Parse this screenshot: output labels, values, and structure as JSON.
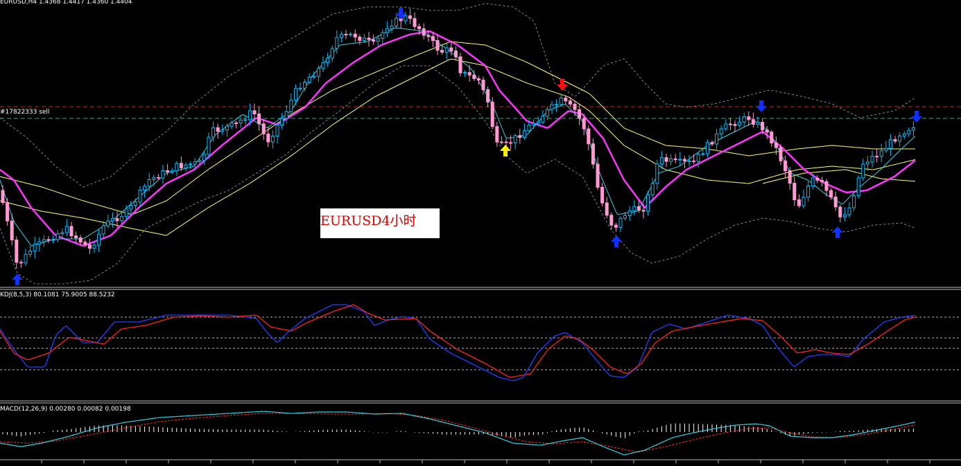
{
  "chart_data": [
    {
      "type": "candlestick",
      "panel": "main",
      "title": "EURUSD,H4  1.4368 1.4417 1.4360 1.4404",
      "symbol": "EURUSD",
      "timeframe": "H4",
      "ohlc_last": {
        "open": 1.4368,
        "high": 1.4417,
        "low": 1.436,
        "close": 1.4404
      },
      "order_line_label": "#17822333 sell",
      "annotation": "EURUSD4小时",
      "colors": {
        "bull": "#00bfff",
        "bear": "#ff9ad2",
        "ma_fast": "#ff33ff",
        "ma_slow": "#ffff66",
        "bands": "#888888",
        "arrow_signal": "#1030ff",
        "arrow_alt_up": "#ffee00",
        "arrow_alt_down": "#ff1010",
        "order_line": "#cc2222",
        "order_line2": "#33aa77"
      }
    },
    {
      "type": "line",
      "panel": "kdj",
      "title": "KDJ(8,5,3) 80.1081 75.9005 88.5232",
      "values": {
        "K": 80.1081,
        "D": 75.9005,
        "J": 88.5232
      },
      "levels": [
        80,
        60,
        50,
        20
      ],
      "colors": {
        "K": "#2040ff",
        "D": "#ff2020",
        "levels": "#ffffff"
      }
    },
    {
      "type": "line",
      "panel": "macd",
      "title": "MACD(12,26,9) 0.00280 0.00082 0.00198",
      "values": {
        "macd": 0.0028,
        "signal": 0.00082,
        "histogram": 0.00198
      },
      "colors": {
        "macd": "#33d0e0",
        "signal": "#ff3030",
        "histogram": "#ffffff"
      }
    }
  ]
}
